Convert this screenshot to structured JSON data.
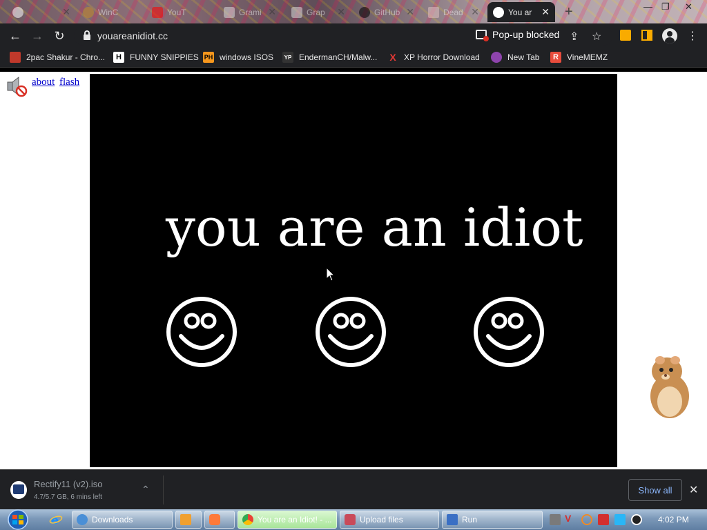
{
  "browser": {
    "tabs": [
      {
        "label": "",
        "favicon_color": "#ffffff",
        "active": false
      },
      {
        "label": "WinC",
        "favicon_color": "#c58a2a",
        "active": false
      },
      {
        "label": "",
        "favicon_color": "#6a4c4c",
        "active": false
      },
      {
        "label": "YouT",
        "favicon_color": "#ff0000",
        "active": false
      },
      {
        "label": "Grami",
        "favicon_color": "#d9d9d9",
        "active": false
      },
      {
        "label": "Grap",
        "favicon_color": "#d9d9d9",
        "active": false
      },
      {
        "label": "GitHub",
        "favicon_color": "#000000",
        "active": false
      },
      {
        "label": "Dead",
        "favicon_color": "#e0c0c0",
        "active": false
      },
      {
        "label": "You ar",
        "favicon_color": "#ffffff",
        "active": true
      }
    ],
    "new_tab_symbol": "+",
    "close_symbol": "✕",
    "window_controls": {
      "minimize": "—",
      "restore": "❐",
      "close": "✕"
    }
  },
  "toolbar": {
    "back_icon": "←",
    "forward_icon": "→",
    "reload_icon": "↻",
    "url": "youareanidiot.cc",
    "popup_blocked_label": "Pop-up blocked",
    "share_icon": "⇪",
    "star_icon": "☆",
    "menu_icon": "⋮"
  },
  "bookmarks": [
    {
      "label": "2pac Shakur - Chro...",
      "icon_text": "",
      "icon_bg": "#c0392b"
    },
    {
      "label": "FUNNY SNIPPIES",
      "icon_text": "H",
      "icon_bg": "#ffffff"
    },
    {
      "label": "windows ISOS",
      "icon_text": "PH",
      "icon_bg": "#f7971d"
    },
    {
      "label": "EndermanCH/Malw...",
      "icon_text": "YP",
      "icon_bg": "#333333"
    },
    {
      "label": "XP Horror Download",
      "icon_text": "X",
      "icon_bg": "#202124"
    },
    {
      "label": "New Tab",
      "icon_text": "",
      "icon_bg": "#8e44ad"
    },
    {
      "label": "VineMEMZ",
      "icon_text": "R",
      "icon_bg": "#e74c3c"
    }
  ],
  "page": {
    "links": {
      "about": "about",
      "flash": "flash"
    },
    "headline": "you are an idiot",
    "smiley_count": 3
  },
  "download": {
    "filename": "Rectify11 (v2).iso",
    "status": "4.7/5.7 GB, 6 mins left",
    "chevron": "⌃",
    "show_all": "Show all",
    "close_icon": "✕"
  },
  "taskbar": {
    "tasks": [
      {
        "label": "Downloads"
      },
      {
        "label": ""
      },
      {
        "label": ""
      },
      {
        "label": "You are an Idiot! - ..."
      },
      {
        "label": "Upload files"
      },
      {
        "label": "Run"
      }
    ],
    "clock": "4:02 PM"
  }
}
